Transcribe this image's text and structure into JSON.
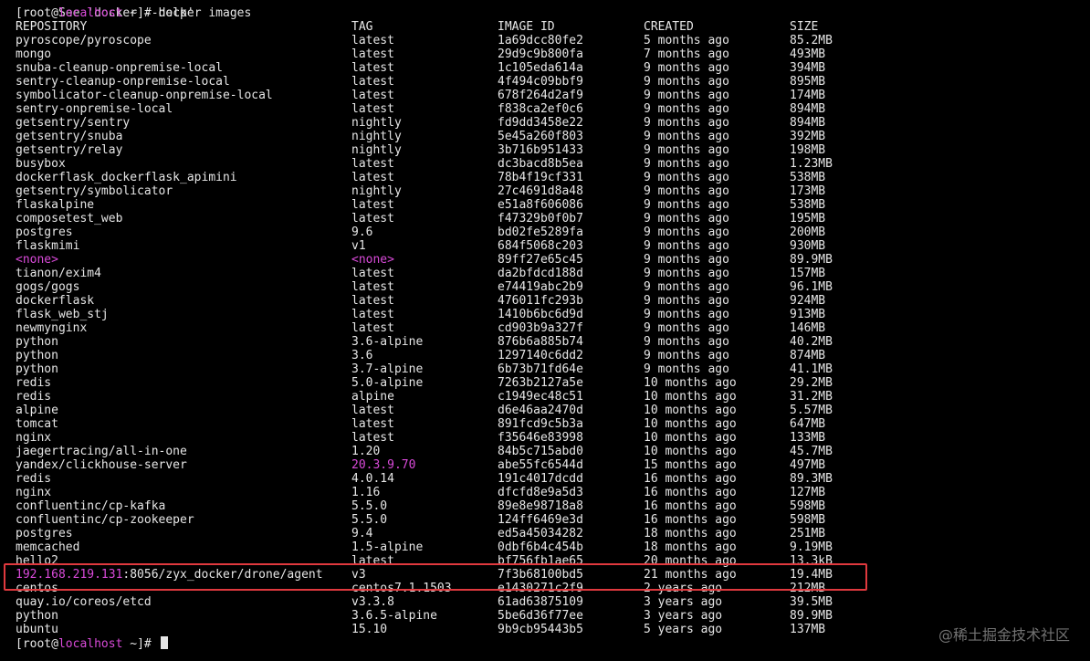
{
  "help_fragment": "See 'docker --help'",
  "prompt": {
    "open": "[root@",
    "host": "localhost",
    "close": " ~]# ",
    "command": "docker images"
  },
  "headers": {
    "repository": "REPOSITORY",
    "tag": "TAG",
    "image_id": "IMAGE ID",
    "created": "CREATED",
    "size": "SIZE"
  },
  "images": [
    {
      "repo": "pyroscope/pyroscope",
      "tag": "latest",
      "id": "1a69dcc80fe2",
      "created": "5 months ago",
      "size": "85.2MB"
    },
    {
      "repo": "mongo",
      "tag": "latest",
      "id": "29d9c9b800fa",
      "created": "7 months ago",
      "size": "493MB"
    },
    {
      "repo": "snuba-cleanup-onpremise-local",
      "tag": "latest",
      "id": "1c105eda614a",
      "created": "9 months ago",
      "size": "394MB"
    },
    {
      "repo": "sentry-cleanup-onpremise-local",
      "tag": "latest",
      "id": "4f494c09bbf9",
      "created": "9 months ago",
      "size": "895MB"
    },
    {
      "repo": "symbolicator-cleanup-onpremise-local",
      "tag": "latest",
      "id": "678f264d2af9",
      "created": "9 months ago",
      "size": "174MB"
    },
    {
      "repo": "sentry-onpremise-local",
      "tag": "latest",
      "id": "f838ca2ef0c6",
      "created": "9 months ago",
      "size": "894MB"
    },
    {
      "repo": "getsentry/sentry",
      "tag": "nightly",
      "id": "fd9dd3458e22",
      "created": "9 months ago",
      "size": "894MB"
    },
    {
      "repo": "getsentry/snuba",
      "tag": "nightly",
      "id": "5e45a260f803",
      "created": "9 months ago",
      "size": "392MB"
    },
    {
      "repo": "getsentry/relay",
      "tag": "nightly",
      "id": "3b716b951433",
      "created": "9 months ago",
      "size": "198MB"
    },
    {
      "repo": "busybox",
      "tag": "latest",
      "id": "dc3bacd8b5ea",
      "created": "9 months ago",
      "size": "1.23MB"
    },
    {
      "repo": "dockerflask_dockerflask_apimini",
      "tag": "latest",
      "id": "78b4f19cf331",
      "created": "9 months ago",
      "size": "538MB"
    },
    {
      "repo": "getsentry/symbolicator",
      "tag": "nightly",
      "id": "27c4691d8a48",
      "created": "9 months ago",
      "size": "173MB"
    },
    {
      "repo": "flaskalpine",
      "tag": "latest",
      "id": "e51a8f606086",
      "created": "9 months ago",
      "size": "538MB"
    },
    {
      "repo": "composetest_web",
      "tag": "latest",
      "id": "f47329b0f0b7",
      "created": "9 months ago",
      "size": "195MB"
    },
    {
      "repo": "postgres",
      "tag": "9.6",
      "id": "bd02fe5289fa",
      "created": "9 months ago",
      "size": "200MB"
    },
    {
      "repo": "flaskmimi",
      "tag": "v1",
      "id": "684f5068c203",
      "created": "9 months ago",
      "size": "930MB"
    },
    {
      "repo": "<none>",
      "tag": "<none>",
      "id": "89ff27e65c45",
      "created": "9 months ago",
      "size": "89.9MB",
      "repo_color": "magenta",
      "tag_color": "magenta"
    },
    {
      "repo": "tianon/exim4",
      "tag": "latest",
      "id": "da2bfdcd188d",
      "created": "9 months ago",
      "size": "157MB"
    },
    {
      "repo": "gogs/gogs",
      "tag": "latest",
      "id": "e74419abc2b9",
      "created": "9 months ago",
      "size": "96.1MB"
    },
    {
      "repo": "dockerflask",
      "tag": "latest",
      "id": "476011fc293b",
      "created": "9 months ago",
      "size": "924MB"
    },
    {
      "repo": "flask_web_stj",
      "tag": "latest",
      "id": "1410b6bc6d9d",
      "created": "9 months ago",
      "size": "913MB"
    },
    {
      "repo": "newmynginx",
      "tag": "latest",
      "id": "cd903b9a327f",
      "created": "9 months ago",
      "size": "146MB"
    },
    {
      "repo": "python",
      "tag": "3.6-alpine",
      "id": "876b6a885b74",
      "created": "9 months ago",
      "size": "40.2MB"
    },
    {
      "repo": "python",
      "tag": "3.6",
      "id": "1297140c6dd2",
      "created": "9 months ago",
      "size": "874MB"
    },
    {
      "repo": "python",
      "tag": "3.7-alpine",
      "id": "6b73b71fd64e",
      "created": "9 months ago",
      "size": "41.1MB"
    },
    {
      "repo": "redis",
      "tag": "5.0-alpine",
      "id": "7263b2127a5e",
      "created": "10 months ago",
      "size": "29.2MB"
    },
    {
      "repo": "redis",
      "tag": "alpine",
      "id": "c1949ec48c51",
      "created": "10 months ago",
      "size": "31.2MB"
    },
    {
      "repo": "alpine",
      "tag": "latest",
      "id": "d6e46aa2470d",
      "created": "10 months ago",
      "size": "5.57MB"
    },
    {
      "repo": "tomcat",
      "tag": "latest",
      "id": "891fcd9c5b3a",
      "created": "10 months ago",
      "size": "647MB"
    },
    {
      "repo": "nginx",
      "tag": "latest",
      "id": "f35646e83998",
      "created": "10 months ago",
      "size": "133MB"
    },
    {
      "repo": "jaegertracing/all-in-one",
      "tag": "1.20",
      "id": "84b5c715abd0",
      "created": "10 months ago",
      "size": "45.7MB"
    },
    {
      "repo": "yandex/clickhouse-server",
      "tag": "20.3.9.70",
      "id": "abe55fc6544d",
      "created": "15 months ago",
      "size": "497MB",
      "tag_color": "magenta"
    },
    {
      "repo": "redis",
      "tag": "4.0.14",
      "id": "191c4017dcdd",
      "created": "16 months ago",
      "size": "89.3MB"
    },
    {
      "repo": "nginx",
      "tag": "1.16",
      "id": "dfcfd8e9a5d3",
      "created": "16 months ago",
      "size": "127MB"
    },
    {
      "repo": "confluentinc/cp-kafka",
      "tag": "5.5.0",
      "id": "89e8e98718a8",
      "created": "16 months ago",
      "size": "598MB"
    },
    {
      "repo": "confluentinc/cp-zookeeper",
      "tag": "5.5.0",
      "id": "124ff6469e3d",
      "created": "16 months ago",
      "size": "598MB"
    },
    {
      "repo": "postgres",
      "tag": "9.4",
      "id": "ed5a45034282",
      "created": "18 months ago",
      "size": "251MB"
    },
    {
      "repo": "memcached",
      "tag": "1.5-alpine",
      "id": "0dbf6b4c454b",
      "created": "18 months ago",
      "size": "9.19MB"
    },
    {
      "repo": "hello2",
      "tag": "latest",
      "id": "bf756fb1ae65",
      "created": "20 months ago",
      "size": "13.3kB"
    },
    {
      "repo_host": "192.168.219.131",
      "repo": ":8056/zyx_docker/drone/agent",
      "tag": "v3",
      "id": "7f3b68100bd5",
      "created": "21 months ago",
      "size": "19.4MB",
      "highlighted": true
    },
    {
      "repo": "centos",
      "tag": "centos7.1.1503",
      "id": "e1430271c2f9",
      "created": "2 years ago",
      "size": "212MB"
    },
    {
      "repo": "quay.io/coreos/etcd",
      "tag": "v3.3.8",
      "id": "61ad63875109",
      "created": "3 years ago",
      "size": "39.5MB"
    },
    {
      "repo": "python",
      "tag": "3.6.5-alpine",
      "id": "5be6d36f77ee",
      "created": "3 years ago",
      "size": "89.9MB"
    },
    {
      "repo": "ubuntu",
      "tag": "15.10",
      "id": "9b9cb95443b5",
      "created": "5 years ago",
      "size": "137MB"
    }
  ],
  "highlight_color": "#e0393e",
  "watermark": "@稀土掘金技术社区"
}
